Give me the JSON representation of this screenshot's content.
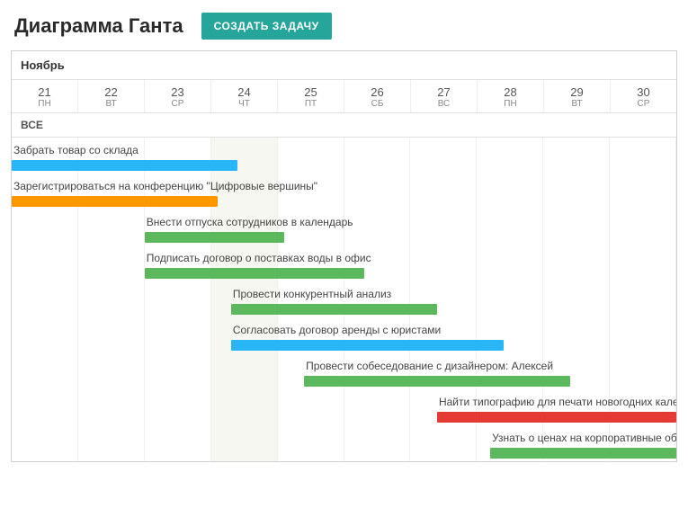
{
  "header": {
    "title": "Диаграмма Ганта",
    "create_button": "СОЗДАТЬ ЗАДАЧУ"
  },
  "timeline": {
    "month": "Ноябрь",
    "all_label": "ВСЕ",
    "days": [
      {
        "num": "21",
        "abbr": "ПН"
      },
      {
        "num": "22",
        "abbr": "ВТ"
      },
      {
        "num": "23",
        "abbr": "СР"
      },
      {
        "num": "24",
        "abbr": "ЧТ"
      },
      {
        "num": "25",
        "abbr": "ПТ"
      },
      {
        "num": "26",
        "abbr": "СБ"
      },
      {
        "num": "27",
        "abbr": "ВС"
      },
      {
        "num": "28",
        "abbr": "ПН"
      },
      {
        "num": "29",
        "abbr": "ВТ"
      },
      {
        "num": "30",
        "abbr": "СР"
      }
    ],
    "today_index": 3
  },
  "colors": {
    "blue": "#29b6f6",
    "orange": "#ff9800",
    "green": "#5cb85c",
    "red": "#e53935",
    "accent": "#26a69a"
  },
  "chart_data": {
    "type": "bar",
    "title": "Диаграмма Ганта",
    "xlabel": "Ноябрь",
    "ylabel": "",
    "categories": [
      "21",
      "22",
      "23",
      "24",
      "25",
      "26",
      "27",
      "28",
      "29",
      "30"
    ],
    "series": [
      {
        "name": "Забрать товар со склада",
        "start_day": 21,
        "end_day": 24,
        "color": "blue",
        "start_col": 0,
        "span_cols": 3.4
      },
      {
        "name": "Зарегистрироваться на конференцию \"Цифровые вершины\"",
        "start_day": 21,
        "end_day": 24,
        "color": "orange",
        "start_col": 0,
        "span_cols": 3.1
      },
      {
        "name": "Внести отпуска сотрудников в календарь",
        "start_day": 23,
        "end_day": 25,
        "color": "green",
        "start_col": 2,
        "span_cols": 2.1
      },
      {
        "name": "Подписать договор о поставках воды в офис",
        "start_day": 23,
        "end_day": 26,
        "color": "green",
        "start_col": 2,
        "span_cols": 3.3
      },
      {
        "name": "Провести конкурентный анализ",
        "start_day": 24,
        "end_day": 27,
        "color": "green",
        "start_col": 3.3,
        "span_cols": 3.1
      },
      {
        "name": "Согласовать договор аренды с юристами",
        "start_day": 24,
        "end_day": 28,
        "color": "blue",
        "start_col": 3.3,
        "span_cols": 4.1
      },
      {
        "name": "Провести собеседование с дизайнером: Алексей",
        "start_day": 25,
        "end_day": 29,
        "color": "green",
        "start_col": 4.4,
        "span_cols": 4.0
      },
      {
        "name": "Найти типографию для печати новогодних календарей",
        "start_day": 27,
        "end_day": 30,
        "color": "red",
        "start_col": 6.4,
        "span_cols": 3.6
      },
      {
        "name": "Узнать о ценах на корпоративные обеды",
        "start_day": 28,
        "end_day": 30,
        "color": "green",
        "start_col": 7.2,
        "span_cols": 2.8
      }
    ]
  }
}
